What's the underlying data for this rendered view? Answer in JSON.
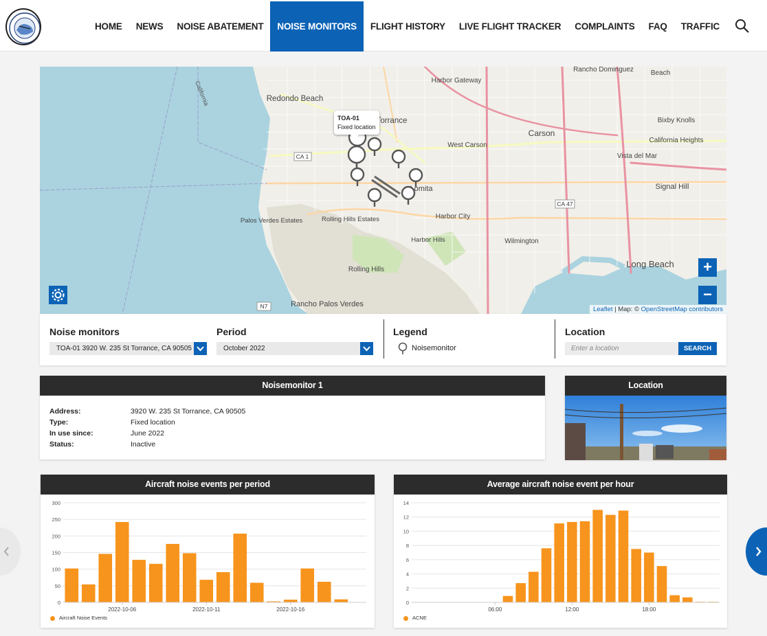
{
  "nav": {
    "items": [
      "HOME",
      "NEWS",
      "NOISE ABATEMENT",
      "NOISE MONITORS",
      "FLIGHT HISTORY",
      "LIVE FLIGHT TRACKER",
      "COMPLAINTS",
      "FAQ",
      "TRAFFIC"
    ],
    "active": "NOISE MONITORS"
  },
  "map": {
    "popup_title": "TOA-01",
    "popup_text": "Fixed location",
    "zoom_in": "+",
    "zoom_out": "−",
    "attribution_leaflet": "Leaflet",
    "attribution_mid": " | Map: © ",
    "attribution_osm": "OpenStreetMap contributors",
    "places": [
      "Rancho Dominguez",
      "Beach",
      "Harbor Gateway",
      "Redondo Beach",
      "Torrance",
      "Carson",
      "Bixby Knolls",
      "West Carson",
      "California Heights",
      "Vista del Mar",
      "Signal Hill",
      "Lomita",
      "Harbor City",
      "Palos Verdes Estates",
      "Rolling Hills Estates",
      "Harbor Hills",
      "Wilmington",
      "Long Beach",
      "Rolling Hills",
      "Rancho Palos Verdes",
      "California"
    ],
    "roads": [
      "CA 1",
      "CA 47",
      "N7"
    ]
  },
  "controls": {
    "noise_label": "Noise monitors",
    "noise_value": "TOA-01 3920 W. 235 St Torrance, CA 90505",
    "period_label": "Period",
    "period_value": "October 2022",
    "legend_label": "Legend",
    "legend_item": "Noisemonitor",
    "location_label": "Location",
    "location_placeholder": "Enter a location",
    "search_btn": "SEARCH"
  },
  "info": {
    "title": "Noisemonitor  1",
    "rows": [
      {
        "k": "Address:",
        "v": "3920 W. 235 St Torrance, CA 90505"
      },
      {
        "k": "Type:",
        "v": "Fixed location"
      },
      {
        "k": "In use since:",
        "v": "June 2022"
      },
      {
        "k": "Status:",
        "v": "Inactive"
      }
    ]
  },
  "location_card": {
    "title": "Location"
  },
  "colors": {
    "accent": "#0c63b6",
    "bar": "#f7941d",
    "header_dark": "#2c2c2c"
  },
  "chart_data": [
    {
      "type": "bar",
      "title": "Aircraft noise events per period",
      "ylim": [
        0,
        300
      ],
      "yticks": [
        0,
        50,
        100,
        150,
        200,
        250,
        300
      ],
      "x": [
        "2022-10-03",
        "2022-10-04",
        "2022-10-05",
        "2022-10-06",
        "2022-10-07",
        "2022-10-08",
        "2022-10-09",
        "2022-10-10",
        "2022-10-11",
        "2022-10-12",
        "2022-10-13",
        "2022-10-14",
        "2022-10-15",
        "2022-10-16",
        "2022-10-17",
        "2022-10-18",
        "2022-10-19",
        "2022-10-20"
      ],
      "xtick_labels": [
        "2022-10-06",
        "2022-10-11",
        "2022-10-16"
      ],
      "series": [
        {
          "name": "Aircraft Noise Events",
          "values": [
            102,
            54,
            146,
            242,
            128,
            116,
            176,
            148,
            68,
            91,
            207,
            59,
            3,
            8,
            102,
            62,
            9,
            0
          ]
        }
      ]
    },
    {
      "type": "bar",
      "title": "Average aircraft noise event per hour",
      "ylim": [
        0,
        14
      ],
      "yticks": [
        0,
        2,
        4,
        6,
        8,
        10,
        12,
        14
      ],
      "x": [
        0,
        1,
        2,
        3,
        4,
        5,
        6,
        7,
        8,
        9,
        10,
        11,
        12,
        13,
        14,
        15,
        16,
        17,
        18,
        19,
        20,
        21,
        22,
        23
      ],
      "xtick_labels": [
        "06:00",
        "12:00",
        "18:00"
      ],
      "series": [
        {
          "name": "ACNE",
          "values": [
            0.02,
            0,
            0,
            0,
            0,
            0,
            0.02,
            0.9,
            2.7,
            4.3,
            7.6,
            11.1,
            11.3,
            11.4,
            13,
            12.3,
            12.9,
            7.5,
            7,
            5.1,
            1.0,
            0.7,
            0.08,
            0.08
          ]
        }
      ]
    }
  ]
}
